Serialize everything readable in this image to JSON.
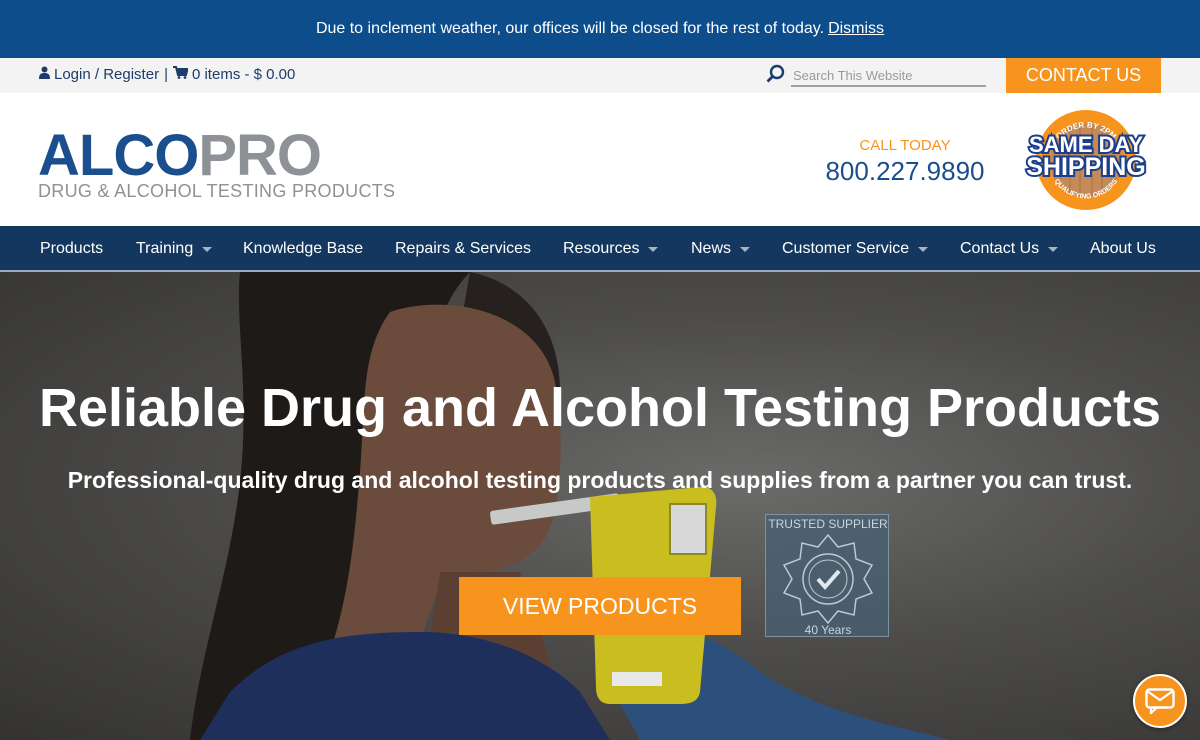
{
  "alert": {
    "message": "Due to inclement weather, our offices will be closed for the rest of today.",
    "dismiss_label": "Dismiss"
  },
  "utility": {
    "login_label": "Login / Register",
    "separator": "|",
    "cart_label": "0 items - $ 0.00",
    "search_placeholder": "Search This Website",
    "contact_button": "CONTACT US"
  },
  "header": {
    "logo_part1": "ALCO",
    "logo_part2": "PRO",
    "logo_tagline": "DRUG & ALCOHOL TESTING PRODUCTS",
    "call_label": "CALL TODAY",
    "phone": "800.227.9890",
    "badge": {
      "top_text": "ORDER BY 2PM",
      "line1": "SAME DAY",
      "line2": "SHIPPING",
      "bottom_text": "QUALIFYING ORDERS"
    }
  },
  "nav": [
    {
      "label": "Products",
      "dropdown": false
    },
    {
      "label": "Training",
      "dropdown": true
    },
    {
      "label": "Knowledge Base",
      "dropdown": false
    },
    {
      "label": "Repairs & Services",
      "dropdown": false
    },
    {
      "label": "Resources",
      "dropdown": true
    },
    {
      "label": "News",
      "dropdown": true
    },
    {
      "label": "Customer Service",
      "dropdown": true
    },
    {
      "label": "Contact Us",
      "dropdown": true
    },
    {
      "label": "About Us",
      "dropdown": false
    }
  ],
  "hero": {
    "title": "Reliable Drug and Alcohol Testing Products",
    "subtitle": "Professional-quality drug and alcohol testing products and supplies from a partner you can trust.",
    "cta_label": "VIEW PRODUCTS",
    "trusted_top": "TRUSTED SUPPLIER",
    "trusted_bottom": "40 Years"
  },
  "colors": {
    "brand_blue": "#1b4e8c",
    "nav_bg": "#13375f",
    "accent_orange": "#f7941d",
    "alert_bg": "#0e4d8c"
  },
  "icons": {
    "user": "user-icon",
    "cart": "cart-icon",
    "search": "search-icon",
    "chat": "chat-icon"
  }
}
